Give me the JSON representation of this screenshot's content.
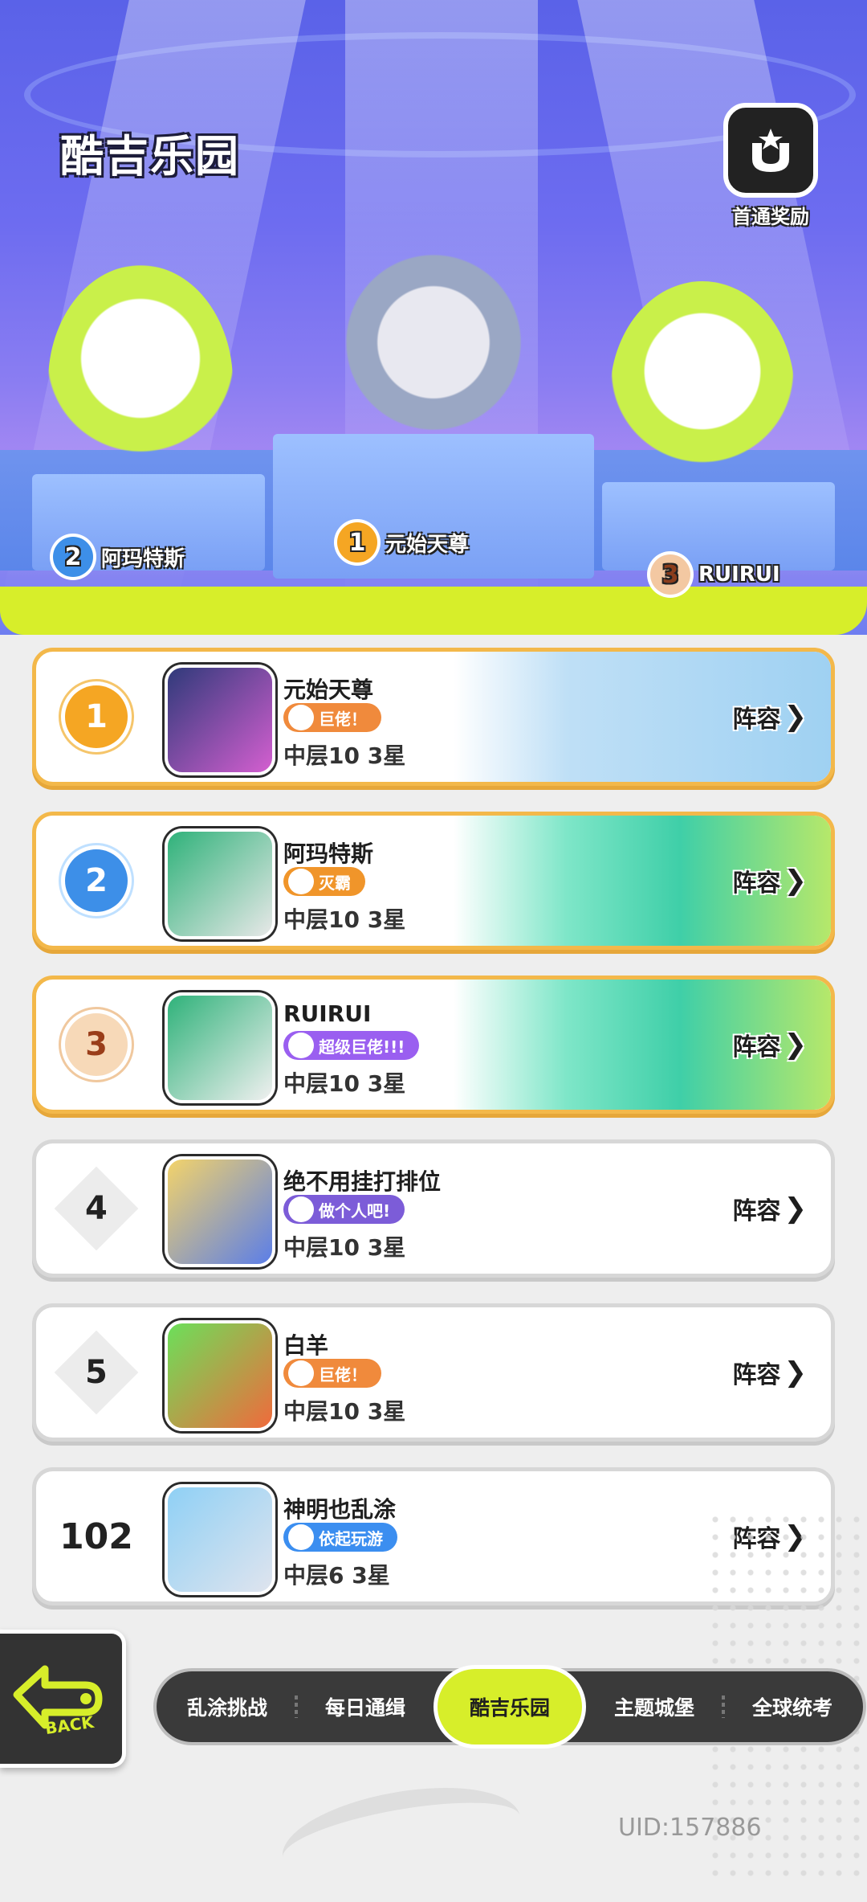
{
  "header": {
    "title": "酷吉乐园",
    "reward_label": "首通奖励",
    "podium": [
      {
        "rank": "2",
        "name": "阿玛特斯"
      },
      {
        "rank": "1",
        "name": "元始天尊"
      },
      {
        "rank": "3",
        "name": "RUIRUI"
      }
    ]
  },
  "ranking": [
    {
      "rank": "1",
      "name": "元始天尊",
      "title": "巨佬！",
      "title_color": "#f08a3c",
      "score": "中层10 3星",
      "lineup": "阵容"
    },
    {
      "rank": "2",
      "name": "阿玛特斯",
      "title": "灭霸",
      "title_color": "#f0952a",
      "score": "中层10 3星",
      "lineup": "阵容"
    },
    {
      "rank": "3",
      "name": "RUIRUI",
      "title": "超级巨佬!!!",
      "title_color": "#9a5ff0",
      "score": "中层10 3星",
      "lineup": "阵容"
    },
    {
      "rank": "4",
      "name": "绝不用挂打排位",
      "title": "做个人吧!",
      "title_color": "#7c5cd8",
      "score": "中层10 3星",
      "lineup": "阵容"
    },
    {
      "rank": "5",
      "name": "白羊",
      "title": "巨佬！",
      "title_color": "#f08a3c",
      "score": "中层10 3星",
      "lineup": "阵容"
    },
    {
      "rank": "102",
      "name": "神明也乱涂",
      "title": "依起玩游",
      "title_color": "#3b8ef0",
      "score": "中层6 3星",
      "lineup": "阵容"
    }
  ],
  "back_label": "BACK",
  "tabs": [
    "乱涂挑战",
    "每日通缉",
    "酷吉乐园",
    "主题城堡",
    "全球统考"
  ],
  "active_tab": "酷吉乐园",
  "uid": "UID:157886",
  "colors": {
    "accent": "#d7ee2a",
    "gold_border": "#f3b84a",
    "header_blue": "#6d6cf0"
  }
}
